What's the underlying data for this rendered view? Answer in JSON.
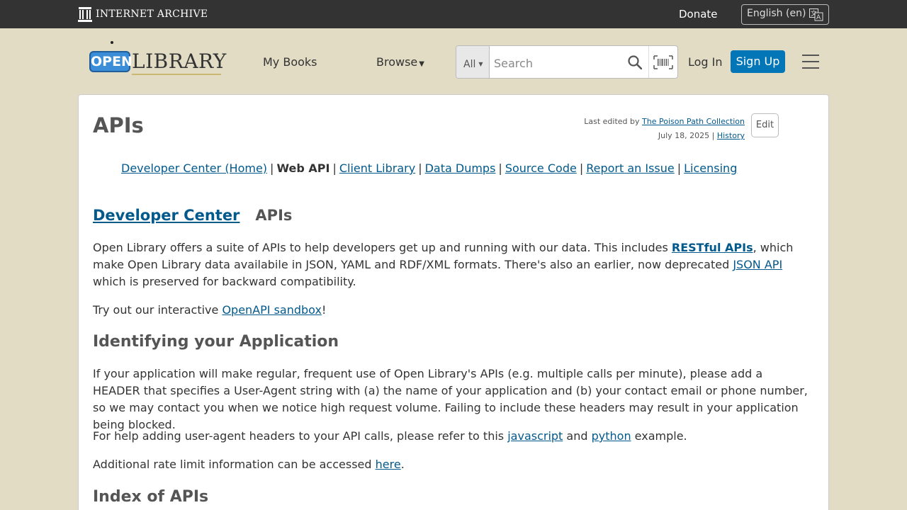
{
  "ia_bar": {
    "logo_text": "INTERNET ARCHIVE",
    "donate": "Donate",
    "language": "English (en)"
  },
  "header": {
    "logo_open": "OPEN",
    "logo_library": "LIBRARY",
    "my_books": "My Books",
    "browse": "Browse",
    "search_scope": "All",
    "search_placeholder": "Search",
    "login": "Log In",
    "signup": "Sign Up"
  },
  "page": {
    "title": "APIs",
    "last_edited_prefix": "Last edited by ",
    "last_edited_by": "The Poison Path Collection",
    "edit_date": "July 18, 2025",
    "history": "History",
    "edit_button": "Edit"
  },
  "devnav": {
    "home": "Developer Center (Home)",
    "current": "Web API",
    "client_library": "Client Library",
    "data_dumps": "Data Dumps",
    "source_code": "Source Code",
    "report_issue": "Report an Issue",
    "licensing": "Licensing"
  },
  "tabs": {
    "dev_center": "Developer Center",
    "current": "APIs"
  },
  "content": {
    "p1_a": "Open Library offers a suite of APIs to help developers get up and running with our data. This includes ",
    "p1_link1": "RESTful APIs",
    "p1_b": ", which make Open Library data availabile in JSON, YAML and RDF/XML formats. There's also an earlier, now deprecated ",
    "p1_link2": "JSON API",
    "p1_c": " which is preserved for backward compatibility.",
    "p2_a": "Try out our interactive ",
    "p2_link": "OpenAPI sandbox",
    "p2_b": "!",
    "h_ident": "Identifying your Application",
    "p3": "If your application will make regular, frequent use of Open Library's APIs (e.g. multiple calls per minute), please add a HEADER that specifies a User-Agent string with (a) the name of your application and (b) your contact email or phone number, so we may contact you when we notice high request volume. Failing to include these headers may result in your application being blocked.",
    "p4_a": "For help adding user-agent headers to your API calls, please refer to this ",
    "p4_link1": "javascript",
    "p4_b": " and ",
    "p4_link2": "python",
    "p4_c": " example.",
    "p5_a": "Additional rate limit information can be accessed ",
    "p5_link": "here",
    "p5_b": ".",
    "h_index": "Index of APIs"
  },
  "colors": {
    "background": "#e2dcc5",
    "ia_bar": "#333333",
    "link": "#02598b",
    "signup": "#0376b8"
  }
}
